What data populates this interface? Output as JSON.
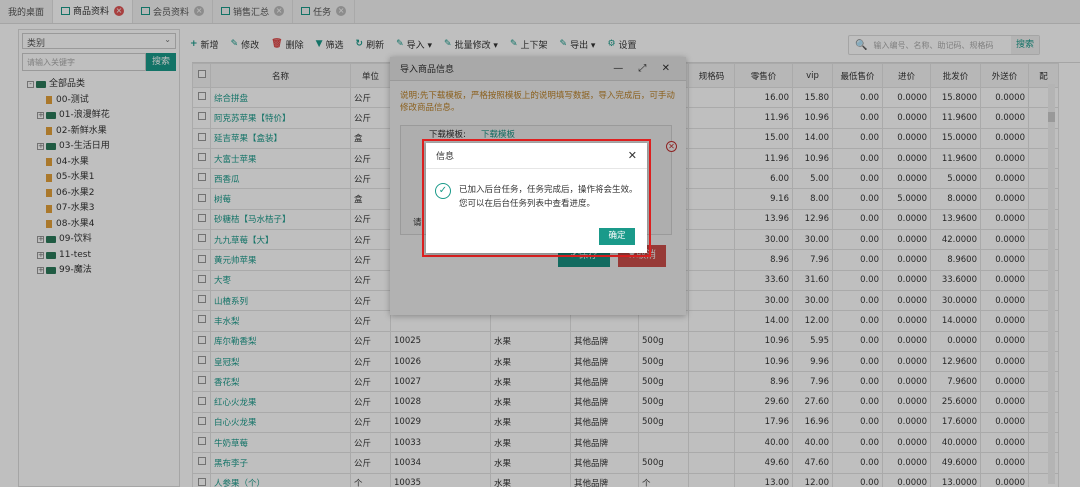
{
  "tabs": [
    {
      "label": "我的桌面",
      "active": false
    },
    {
      "label": "商品资料",
      "active": true
    },
    {
      "label": "会员资料",
      "active": false
    },
    {
      "label": "销售汇总",
      "active": false
    },
    {
      "label": "任务",
      "active": false
    }
  ],
  "sidebar": {
    "category_select": "类别",
    "keyword_placeholder": "请输入关键字",
    "search_btn": "搜索",
    "tree": [
      {
        "label": "全部品类",
        "type": "folder",
        "indent": 0,
        "pm": "-"
      },
      {
        "label": "00-测试",
        "type": "file",
        "indent": 1
      },
      {
        "label": "01-浪漫鲜花",
        "type": "folder",
        "indent": 1,
        "pm": "+"
      },
      {
        "label": "02-新鲜水果",
        "type": "file",
        "indent": 1
      },
      {
        "label": "03-生活日用",
        "type": "folder",
        "indent": 1,
        "pm": "+"
      },
      {
        "label": "04-水果",
        "type": "file",
        "indent": 1
      },
      {
        "label": "05-水果1",
        "type": "file",
        "indent": 1
      },
      {
        "label": "06-水果2",
        "type": "file",
        "indent": 1
      },
      {
        "label": "07-水果3",
        "type": "file",
        "indent": 1
      },
      {
        "label": "08-水果4",
        "type": "file",
        "indent": 1
      },
      {
        "label": "09-饮料",
        "type": "folder",
        "indent": 1,
        "pm": "+"
      },
      {
        "label": "11-test",
        "type": "folder",
        "indent": 1,
        "pm": "+"
      },
      {
        "label": "99-魔法",
        "type": "folder",
        "indent": 1,
        "pm": "+"
      }
    ]
  },
  "toolbar": [
    {
      "icon": "plus-icon",
      "glyph": "+",
      "label": "新增"
    },
    {
      "icon": "edit-icon",
      "glyph": "✎",
      "label": "修改"
    },
    {
      "icon": "trash-icon",
      "glyph": "🗑",
      "label": "删除",
      "red": true
    },
    {
      "icon": "filter-icon",
      "glyph": "▼",
      "label": "筛选"
    },
    {
      "icon": "refresh-icon",
      "glyph": "↻",
      "label": "刷新"
    },
    {
      "icon": "import-icon",
      "glyph": "✎",
      "label": "导入 ▾"
    },
    {
      "icon": "batch-edit-icon",
      "glyph": "✎",
      "label": "批量修改 ▾"
    },
    {
      "icon": "pencil-icon",
      "glyph": "✎",
      "label": "上下架"
    },
    {
      "icon": "export-icon",
      "glyph": "✎",
      "label": "导出 ▾"
    },
    {
      "icon": "gear-icon",
      "glyph": "⚙",
      "label": "设置"
    }
  ],
  "search": {
    "placeholder": "输入编号、名称、助记码、规格码",
    "button": "搜索"
  },
  "table": {
    "headers": [
      "",
      "名称",
      "单位",
      "",
      "",
      "",
      "",
      "规格码",
      "零售价",
      "vip",
      "最低售价",
      "进价",
      "批发价",
      "外送价",
      "配"
    ],
    "rows": [
      [
        "综合拼盘",
        "公斤",
        "",
        "",
        "",
        "",
        "",
        "16.00",
        "15.80",
        "0.00",
        "0.0000",
        "15.8000",
        "0.0000"
      ],
      [
        "阿克苏苹果【特价】",
        "公斤",
        "",
        "",
        "",
        "",
        "",
        "11.96",
        "10.96",
        "0.00",
        "0.0000",
        "11.9600",
        "0.0000"
      ],
      [
        "延吉苹果【盒装】",
        "盒",
        "",
        "",
        "",
        "",
        "",
        "15.00",
        "14.00",
        "0.00",
        "0.0000",
        "15.0000",
        "0.0000"
      ],
      [
        "大富士苹果",
        "公斤",
        "",
        "",
        "",
        "",
        "",
        "11.96",
        "10.96",
        "0.00",
        "0.0000",
        "11.9600",
        "0.0000"
      ],
      [
        "西香瓜",
        "公斤",
        "",
        "",
        "",
        "",
        "",
        "6.00",
        "5.00",
        "0.00",
        "0.0000",
        "5.0000",
        "0.0000"
      ],
      [
        "树莓",
        "盒",
        "",
        "",
        "",
        "",
        "",
        "9.16",
        "8.00",
        "0.00",
        "5.0000",
        "8.0000",
        "0.0000"
      ],
      [
        "砂糖桔【马水桔子】",
        "公斤",
        "",
        "",
        "",
        "",
        "",
        "13.96",
        "12.96",
        "0.00",
        "0.0000",
        "13.9600",
        "0.0000"
      ],
      [
        "九九草莓【大】",
        "公斤",
        "",
        "",
        "",
        "",
        "",
        "30.00",
        "30.00",
        "0.00",
        "0.0000",
        "42.0000",
        "0.0000"
      ],
      [
        "黄元帅苹果",
        "公斤",
        "",
        "",
        "",
        "",
        "",
        "8.96",
        "7.96",
        "0.00",
        "0.0000",
        "8.9600",
        "0.0000"
      ],
      [
        "大枣",
        "公斤",
        "",
        "",
        "",
        "",
        "",
        "33.60",
        "31.60",
        "0.00",
        "0.0000",
        "33.6000",
        "0.0000"
      ],
      [
        "山楂系列",
        "公斤",
        "",
        "",
        "",
        "",
        "",
        "30.00",
        "30.00",
        "0.00",
        "0.0000",
        "30.0000",
        "0.0000"
      ],
      [
        "丰水梨",
        "公斤",
        "",
        "",
        "",
        "",
        "",
        "14.00",
        "12.00",
        "0.00",
        "0.0000",
        "14.0000",
        "0.0000"
      ],
      [
        "库尔勒香梨",
        "公斤",
        "10025",
        "水果",
        "其他品牌",
        "500g",
        "",
        "10.96",
        "5.95",
        "0.00",
        "0.0000",
        "0.0000",
        "0.0000"
      ],
      [
        "皇冠梨",
        "公斤",
        "10026",
        "水果",
        "其他品牌",
        "500g",
        "",
        "10.96",
        "9.96",
        "0.00",
        "0.0000",
        "12.9600",
        "0.0000"
      ],
      [
        "香花梨",
        "公斤",
        "10027",
        "水果",
        "其他品牌",
        "500g",
        "",
        "8.96",
        "7.96",
        "0.00",
        "0.0000",
        "7.9600",
        "0.0000"
      ],
      [
        "红心火龙果",
        "公斤",
        "10028",
        "水果",
        "其他品牌",
        "500g",
        "",
        "29.60",
        "27.60",
        "0.00",
        "0.0000",
        "25.6000",
        "0.0000"
      ],
      [
        "白心火龙果",
        "公斤",
        "10029",
        "水果",
        "其他品牌",
        "500g",
        "",
        "17.96",
        "16.96",
        "0.00",
        "0.0000",
        "17.6000",
        "0.0000"
      ],
      [
        "牛奶草莓",
        "公斤",
        "10033",
        "水果",
        "其他品牌",
        "",
        "",
        "40.00",
        "40.00",
        "0.00",
        "0.0000",
        "40.0000",
        "0.0000"
      ],
      [
        "黑布李子",
        "公斤",
        "10034",
        "水果",
        "其他品牌",
        "500g",
        "",
        "49.60",
        "47.60",
        "0.00",
        "0.0000",
        "49.6000",
        "0.0000"
      ],
      [
        "人参果（个）",
        "个",
        "10035",
        "水果",
        "其他品牌",
        "个",
        "",
        "13.00",
        "12.00",
        "0.00",
        "0.0000",
        "13.0000",
        "0.0000"
      ]
    ]
  },
  "import_dialog": {
    "title": "导入商品信息",
    "controls": "— ⤢ ✕",
    "note": "说明:先下载模板，严格按照模板上的说明填写数据，导入完成后，可手动修改商品信息。",
    "template_label": "下载模板:",
    "template_link": "下载模板",
    "required_label": "请",
    "delete_glyph": "✕",
    "save": "✔保存",
    "cancel": "✖取消"
  },
  "info_dialog": {
    "title": "信息",
    "close": "✕",
    "check": "✓",
    "message": "已加入后台任务，任务完成后，操作将会生效。您可以在后台任务列表中查看进度。",
    "ok": "确定"
  }
}
